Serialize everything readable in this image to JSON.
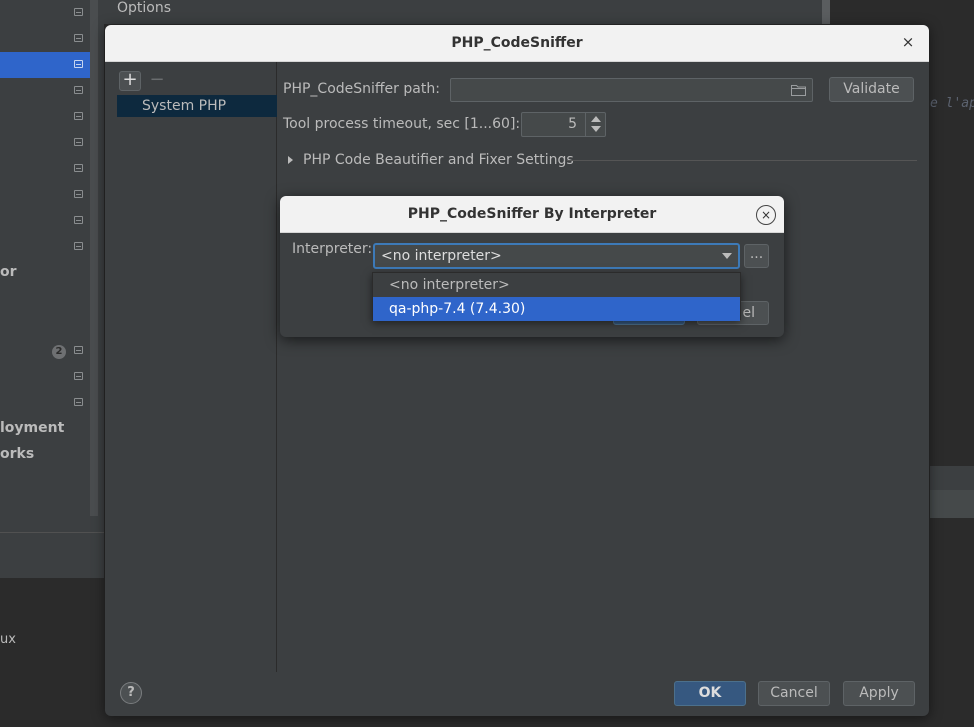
{
  "background": {
    "options_label": "Options",
    "editor_text": "e l'ap",
    "sidebar_labels": [
      "or",
      "loyment",
      "orks"
    ],
    "badge_count": "2",
    "lower_text": "ux"
  },
  "main_dialog": {
    "title": "PHP_CodeSniffer",
    "close_glyph": "×",
    "add_glyph": "+",
    "remove_glyph": "−",
    "list_items": [
      "System PHP"
    ],
    "path_label": "PHP_CodeSniffer path:",
    "path_value": "",
    "validate_label": "Validate",
    "timeout_label": "Tool process timeout, sec [1...60]:",
    "timeout_value": "5",
    "section_label": "PHP Code Beautifier and Fixer Settings",
    "help_glyph": "?",
    "ok_label": "OK",
    "cancel_label": "Cancel",
    "apply_label": "Apply"
  },
  "interpreter_dialog": {
    "title": "PHP_CodeSniffer By Interpreter",
    "close_glyph": "×",
    "interpreter_label": "Interpreter:",
    "selected_value": "<no interpreter>",
    "browse_label": "...",
    "cancel_label_visible": "el",
    "options": [
      "<no interpreter>",
      "qa-php-7.4 (7.4.30)"
    ],
    "highlighted_option": "qa-php-7.4 (7.4.30)"
  },
  "colors": {
    "dialog_bg": "#3c3f41",
    "titlebar_bg": "#f2f2f2",
    "selection": "#2f65ca",
    "default_button": "#365880"
  }
}
